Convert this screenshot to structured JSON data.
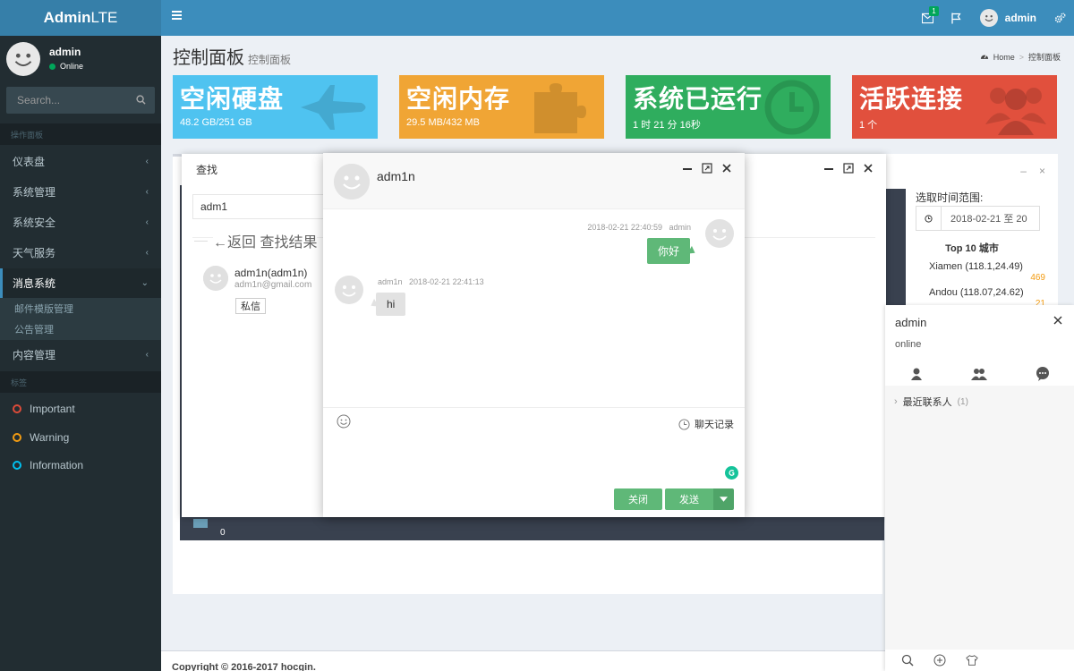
{
  "header": {
    "logo_bold": "Admin",
    "logo_light": "LTE",
    "mail_badge": "1",
    "user_name": "admin",
    "icons": [
      "bars-icon",
      "envelope-icon",
      "flag-icon",
      "gears-icon"
    ]
  },
  "sidebar": {
    "user_name": "admin",
    "user_status": "Online",
    "search_placeholder": "Search...",
    "section_main": "操作面板",
    "section_labels": "标签",
    "menu": [
      {
        "label": "仪表盘"
      },
      {
        "label": "系统管理"
      },
      {
        "label": "系统安全"
      },
      {
        "label": "天气服务"
      },
      {
        "label": "消息系统"
      },
      {
        "label": "内容管理"
      }
    ],
    "submenu": [
      "邮件模版管理",
      "公告管理"
    ],
    "labels": [
      {
        "label": "Important",
        "color": "#dd4b39"
      },
      {
        "label": "Warning",
        "color": "#f39c12"
      },
      {
        "label": "Information",
        "color": "#00c0ef"
      }
    ]
  },
  "page": {
    "title": "控制面板",
    "subtitle": "控制面板",
    "breadcrumb_home": "Home",
    "breadcrumb_current": "控制面板",
    "footer": "Copyright © 2016-2017 hocgin."
  },
  "info_boxes": [
    {
      "title": "空闲硬盘",
      "value": "48.2 GB/251 GB",
      "color": "#4fc3f0",
      "icon": "space-shuttle-icon"
    },
    {
      "title": "空闲内存",
      "value": "29.5 MB/432 MB",
      "color": "#f0a535",
      "icon": "puzzle-icon"
    },
    {
      "title": "系统已运行",
      "value": "1 时 21 分 16秒",
      "color": "#2fad5e",
      "icon": "clock-icon"
    },
    {
      "title": "活跃连接",
      "value": "1 个",
      "color": "#e1503d",
      "icon": "users-icon"
    }
  ],
  "find_window": {
    "title": "查找",
    "input_value": "adm1",
    "back_text": "←返回 查找结果",
    "result_name": "adm1n(adm1n)",
    "result_email": "adm1n@gmail.com",
    "result_button": "私信",
    "strip_count": "0"
  },
  "right_panel": {
    "range_label": "选取时间范围:",
    "date_value": "2018-02-21 至 20",
    "top10_title": "Top 10 城市",
    "cities": [
      {
        "name": "Xiamen (118.1,24.49)",
        "count": "469"
      },
      {
        "name": "Andou (118.07,24.62)",
        "count": "21"
      }
    ]
  },
  "im_panel": {
    "name": "admin",
    "status": "online",
    "group_label": "最近联系人",
    "group_count": "(1)"
  },
  "chat": {
    "contact_name": "adm1n",
    "messages": [
      {
        "sender": "admin",
        "time": "2018-02-21 22:40:59",
        "text": "你好",
        "mine": true
      },
      {
        "sender": "adm1n",
        "time": "2018-02-21 22:41:13",
        "text": "hi",
        "mine": false
      }
    ],
    "history_label": "聊天记录",
    "close_label": "关闭",
    "send_label": "发送"
  }
}
